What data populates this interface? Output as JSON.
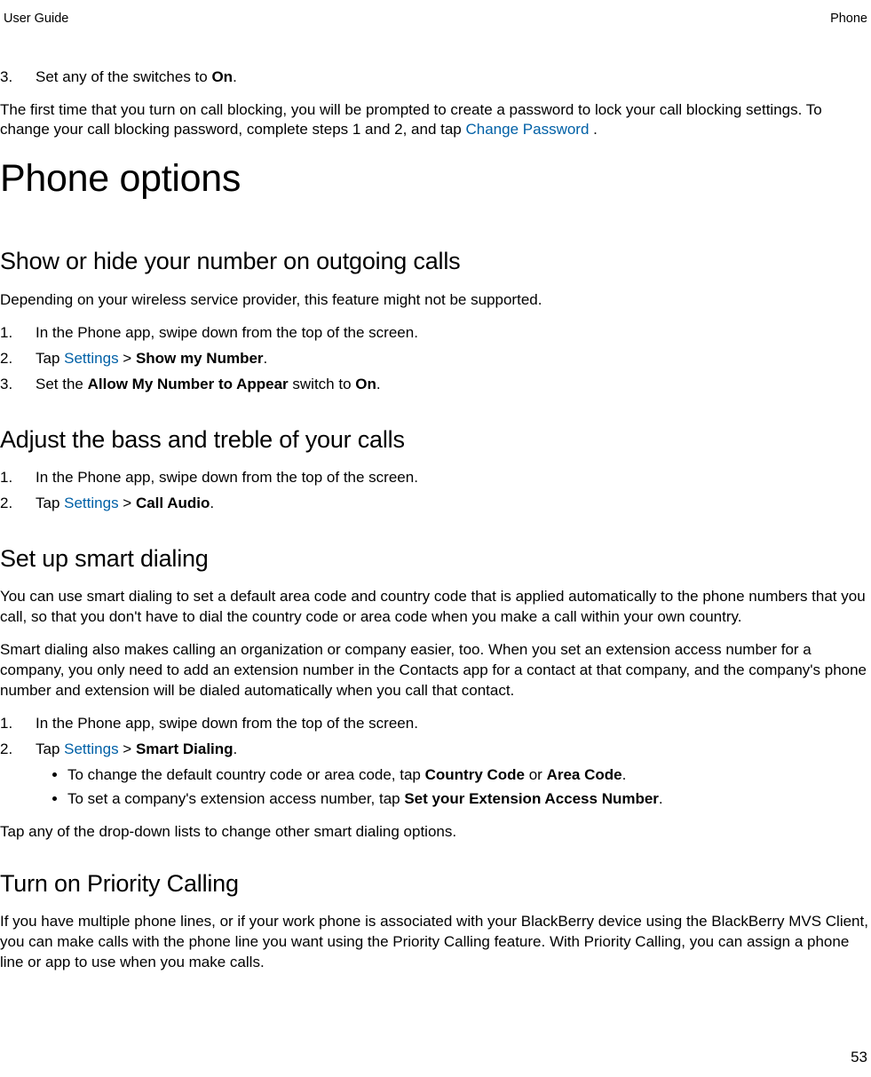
{
  "header": {
    "left": "User Guide",
    "right": "Phone"
  },
  "intro": {
    "step3_marker": "3.",
    "step3_pre": "Set any of the switches to ",
    "step3_bold": "On",
    "step3_post": ".",
    "p1a": "The first time that you turn on call blocking, you will be prompted to create a password to lock your call blocking settings. To change your call blocking password, complete steps 1 and 2, and tap ",
    "p1_link": "Change Password",
    "p1b": " ."
  },
  "h1": "Phone options",
  "sec1": {
    "title": "Show or hide your number on outgoing calls",
    "p": "Depending on your wireless service provider, this feature might not be supported.",
    "items": {
      "m1": "1.",
      "t1": "In the Phone app, swipe down from the top of the screen.",
      "m2": "2.",
      "t2_pre": "Tap ",
      "t2_link": "Settings",
      "t2_mid": "  > ",
      "t2_bold": "Show my Number",
      "t2_post": ".",
      "m3": "3.",
      "t3_pre": "Set the ",
      "t3_bold1": "Allow My Number to Appear",
      "t3_mid": " switch to ",
      "t3_bold2": "On",
      "t3_post": "."
    }
  },
  "sec2": {
    "title": "Adjust the bass and treble of your calls",
    "items": {
      "m1": "1.",
      "t1": "In the Phone app, swipe down from the top of the screen.",
      "m2": "2.",
      "t2_pre": "Tap ",
      "t2_link": "Settings",
      "t2_mid": "  > ",
      "t2_bold": "Call Audio",
      "t2_post": "."
    }
  },
  "sec3": {
    "title": "Set up smart dialing",
    "p1": "You can use smart dialing to set a default area code and country code that is applied automatically to the phone numbers that you call, so that you don't have to dial the country code or area code when you make a call within your own country.",
    "p2": "Smart dialing also makes calling an organization or company easier, too. When you set an extension access number for a company, you only need to add an extension number in the Contacts app for a contact at that company, and the company's phone number and extension will be dialed automatically when you call that contact.",
    "items": {
      "m1": "1.",
      "t1": "In the Phone app, swipe down from the top of the screen.",
      "m2": "2.",
      "t2_pre": "Tap ",
      "t2_link": "Settings",
      "t2_mid": "  > ",
      "t2_bold": "Smart Dialing",
      "t2_post": "."
    },
    "bullets": {
      "b1_pre": "To change the default country code or area code, tap ",
      "b1_bold1": "Country Code",
      "b1_mid": " or ",
      "b1_bold2": "Area Code",
      "b1_post": ".",
      "b2_pre": "To set a company's extension access number, tap ",
      "b2_bold": "Set your Extension Access Number",
      "b2_post": "."
    },
    "p3": "Tap any of the drop-down lists to change other smart dialing options."
  },
  "sec4": {
    "title": "Turn on Priority Calling",
    "p": "If you have multiple phone lines, or if your work phone is associated with your BlackBerry device using the BlackBerry MVS Client, you can make calls with the phone line you want using the Priority Calling feature. With Priority Calling, you can assign a phone line or app to use when you make calls."
  },
  "pageNumber": "53"
}
